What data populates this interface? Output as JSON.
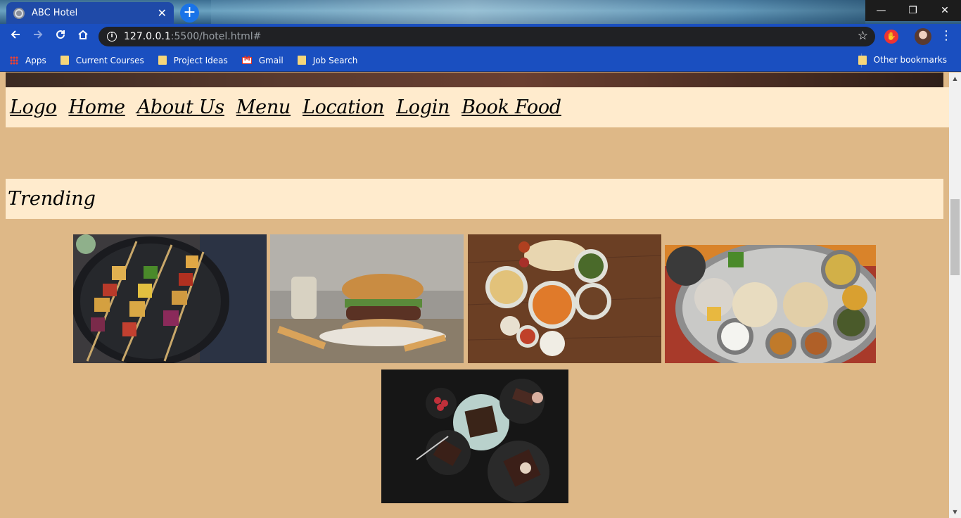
{
  "browser": {
    "tab_title": "ABC Hotel",
    "close_glyph": "✕",
    "new_tab_glyph": "+",
    "url_host": "127.0.0.1",
    "url_path": ":5500/hotel.html#",
    "window_controls": {
      "minimize": "—",
      "restore": "❐",
      "close": "✕"
    },
    "bookmarks": [
      "Apps",
      "Current Courses",
      "Project Ideas",
      "Gmail",
      "Job Search"
    ],
    "other_bookmarks": "Other bookmarks"
  },
  "page": {
    "nav": [
      "Logo",
      "Home",
      "About Us",
      "Menu",
      "Location",
      "Login",
      "Book Food"
    ],
    "section_title": "Trending",
    "images": [
      {
        "icon": "paneer-tikka-skewers-image"
      },
      {
        "icon": "burger-image"
      },
      {
        "icon": "indian-curries-spread-image"
      },
      {
        "icon": "thali-platter-image"
      },
      {
        "icon": "chocolate-cake-image"
      }
    ]
  },
  "colors": {
    "page_background": "#deb887",
    "nav_background": "#ffebcd",
    "chrome_blue": "#1a4fc0"
  }
}
